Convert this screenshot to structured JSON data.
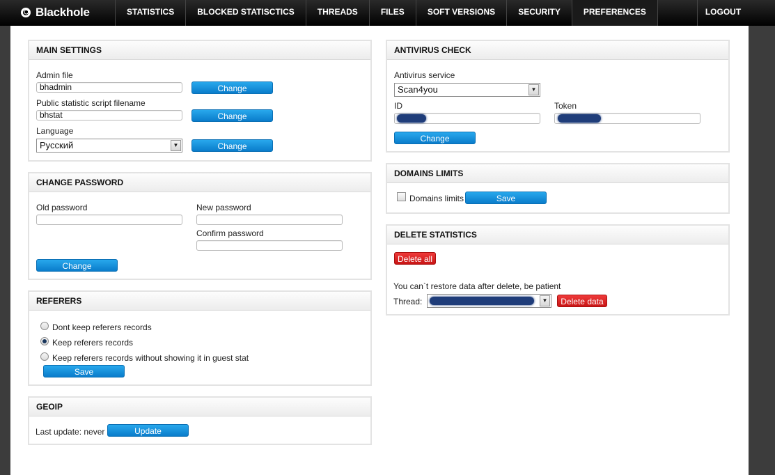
{
  "app": {
    "logo_text": "Blackhole"
  },
  "nav": {
    "items": [
      {
        "label": "STATISTICS"
      },
      {
        "label": "BLOCKED STATISCTICS"
      },
      {
        "label": "THREADS"
      },
      {
        "label": "FILES"
      },
      {
        "label": "SOFT VERSIONS"
      },
      {
        "label": "SECURITY"
      },
      {
        "label": "PREFERENCES",
        "active": true
      }
    ],
    "logout": "LOGOUT"
  },
  "main_settings": {
    "title": "MAIN SETTINGS",
    "admin_file_label": "Admin file",
    "admin_file_value": "bhadmin",
    "public_script_label": "Public statistic script filename",
    "public_script_value": "bhstat",
    "language_label": "Language",
    "language_value": "Русский",
    "change_label": "Change"
  },
  "change_password": {
    "title": "CHANGE PASSWORD",
    "old_label": "Old password",
    "new_label": "New password",
    "confirm_label": "Confirm password",
    "change_label": "Change"
  },
  "referers": {
    "title": "REFERERS",
    "options": [
      {
        "label": "Dont keep referers records",
        "checked": false
      },
      {
        "label": "Keep referers records",
        "checked": true
      },
      {
        "label": "Keep referers records without showing it in guest stat",
        "checked": false
      }
    ],
    "save_label": "Save"
  },
  "geoip": {
    "title": "GEOIP",
    "last_update": "Last update: never",
    "update_label": "Update"
  },
  "antivirus": {
    "title": "ANTIVIRUS CHECK",
    "service_label": "Antivirus service",
    "service_value": "Scan4you",
    "id_label": "ID",
    "token_label": "Token",
    "change_label": "Change"
  },
  "domains_limits": {
    "title": "DOMAINS LIMITS",
    "checkbox_label": "Domains limits",
    "save_label": "Save"
  },
  "delete_statistics": {
    "title": "DELETE STATISTICS",
    "delete_all_label": "Delete all",
    "warning": "You can`t restore data after delete, be patient",
    "thread_label": "Thread:",
    "delete_data_label": "Delete data"
  },
  "colors": {
    "button_blue": "#0a7ccb",
    "button_red": "#c81414",
    "topbar": "#000000",
    "redaction": "#1f3d7a"
  }
}
